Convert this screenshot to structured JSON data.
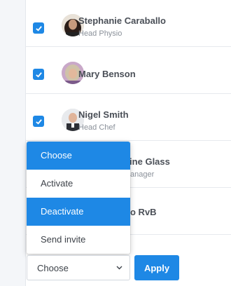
{
  "users": [
    {
      "name": "Stephanie Caraballo",
      "role": "Head Physio",
      "checked": true
    },
    {
      "name": "Mary Benson",
      "role": "",
      "checked": true
    },
    {
      "name": "Nigel Smith",
      "role": "Head Chef",
      "checked": true
    },
    {
      "name": "rine Glass",
      "role": "anager",
      "checked": false
    },
    {
      "name": "o RvB",
      "role": "",
      "checked": false
    }
  ],
  "action_menu": {
    "options": [
      "Choose",
      "Activate",
      "Deactivate",
      "Send invite"
    ],
    "highlighted": [
      "Choose",
      "Deactivate"
    ]
  },
  "bulk_actions": {
    "select_value": "Choose",
    "apply_label": "Apply"
  },
  "colors": {
    "accent": "#1e88e5",
    "text_dark": "#4a4f57",
    "text_muted": "#8a9099"
  }
}
